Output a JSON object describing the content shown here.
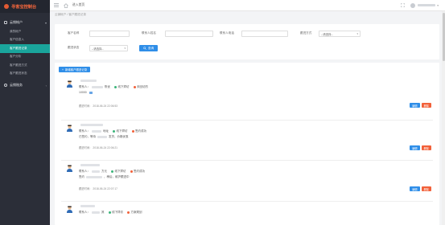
{
  "app": {
    "title": "寻客宝控制台"
  },
  "sidebar": {
    "group1": "云销帐户",
    "items": [
      "我的帐户",
      "客户信息入",
      "客户跟进记录",
      "客户分析",
      "客户跟进方式",
      "客户跟进状态"
    ],
    "group2": "云销账务"
  },
  "topbar": {
    "enter_label": "进入首页"
  },
  "breadcrumb": "云销帐户 / 客户跟进记录",
  "filter": {
    "customer_name": "客户名称",
    "contact_name": "联系人姓名",
    "contact_phone": "联系人电话",
    "follow_method": "跟进方式",
    "follow_status": "跟进状态",
    "select_placeholder": "--请选择--",
    "search_label": "查询"
  },
  "list": {
    "new_label": "新增客户跟进记录",
    "records": [
      {
        "contact_prefix": "联系人：",
        "contact_suffix": "陈优",
        "tag1": "线下拜访",
        "tag2": "未回访的",
        "note": "10000",
        "time": "跟进时间： 2018-06-24 22:06:53"
      },
      {
        "contact_prefix": "联系人：",
        "contact_suffix": "地址",
        "tag1": "线下拜访",
        "tag2": "签约成功",
        "note": "已签约，等待",
        "note2": "发货，价格优惠",
        "time": "跟进时间： 2018-06-24 22:06:21"
      },
      {
        "contact_prefix": "联系人：",
        "contact_suffix": "方元",
        "tag1": "线下拜访",
        "tag2": "签约成功",
        "note": "签约",
        "note2": "，稍后，维护跟进中",
        "time": "跟进时间： 2018-06-24 22:07:17"
      },
      {
        "contact_prefix": "联系人：",
        "contact_suffix": "其",
        "tag1": "线下拜访",
        "tag2": "方案规划",
        "note": "",
        "note2": "",
        "time": ""
      }
    ],
    "edit_label": "编辑",
    "delete_label": "删除"
  },
  "colors": {
    "accent": "#1aa59c",
    "primary": "#2f8ee8",
    "danger": "#f2613a",
    "sidebar": "#2b2e38",
    "logo": "#ff6a3d",
    "dot_green": "#3bb57a",
    "dot_red": "#f2613a"
  },
  "icons": [
    "menu-icon",
    "home-icon",
    "expand-icon",
    "bell-icon",
    "avatar",
    "search-icon",
    "plus-icon",
    "user-avatar-icon"
  ]
}
